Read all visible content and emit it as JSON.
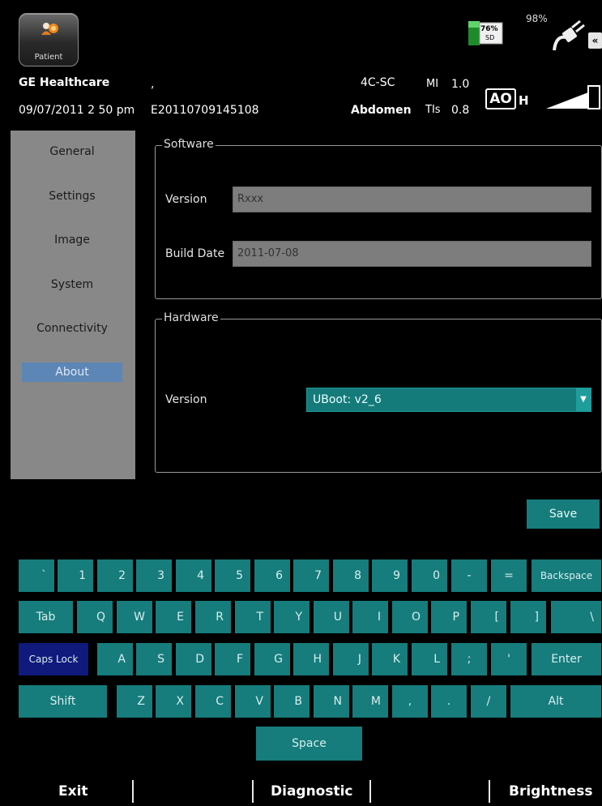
{
  "header": {
    "patient_label": "Patient",
    "sd_percent": "76%",
    "sd_label": "SD",
    "battery_percent": "98%",
    "collapse_symbol": "«",
    "brand": "GE Healthcare",
    "dot": ",",
    "probe": "4C-SC",
    "mi_label": "MI",
    "mi_value": "1.0",
    "datetime": "09/07/2011  2 50 pm",
    "exam_id": "E20110709145108",
    "preset": "Abdomen",
    "tis_label": "TIs",
    "tis_value": "0.8",
    "ao_label": "AO",
    "h_label": "H"
  },
  "sidebar": {
    "items": [
      {
        "label": "General"
      },
      {
        "label": "Settings"
      },
      {
        "label": "Image"
      },
      {
        "label": "System"
      },
      {
        "label": "Connectivity"
      },
      {
        "label": "About"
      }
    ],
    "active": "About"
  },
  "software": {
    "legend": "Software",
    "version_label": "Version",
    "version_value": "Rxxx",
    "build_date_label": "Build Date",
    "build_date_value": "2011-07-08"
  },
  "hardware": {
    "legend": "Hardware",
    "version_label": "Version",
    "version_value": "UBoot: v2_6"
  },
  "save_label": "Save",
  "keyboard": {
    "row1": [
      "`",
      "1",
      "2",
      "3",
      "4",
      "5",
      "6",
      "7",
      "8",
      "9",
      "0",
      "-",
      "=",
      "Backspace"
    ],
    "row2": [
      "Tab",
      "Q",
      "W",
      "E",
      "R",
      "T",
      "Y",
      "U",
      "I",
      "O",
      "P",
      "[",
      "]",
      "\\"
    ],
    "row3": [
      "Caps Lock",
      "A",
      "S",
      "D",
      "F",
      "G",
      "H",
      "J",
      "K",
      "L",
      ";",
      "'",
      "Enter"
    ],
    "row4": [
      "Shift",
      "Z",
      "X",
      "C",
      "V",
      "B",
      "N",
      "M",
      ",",
      ".",
      "/",
      "Alt"
    ],
    "space": "Space"
  },
  "footer": {
    "exit": "Exit",
    "diagnostic": "Diagnostic",
    "brightness": "Brightness"
  },
  "colors": {
    "key_teal": "#167c7c",
    "caps_blue": "#0f1a7c",
    "sidebar_gray": "#888888",
    "active_blue": "#5b86b5"
  }
}
